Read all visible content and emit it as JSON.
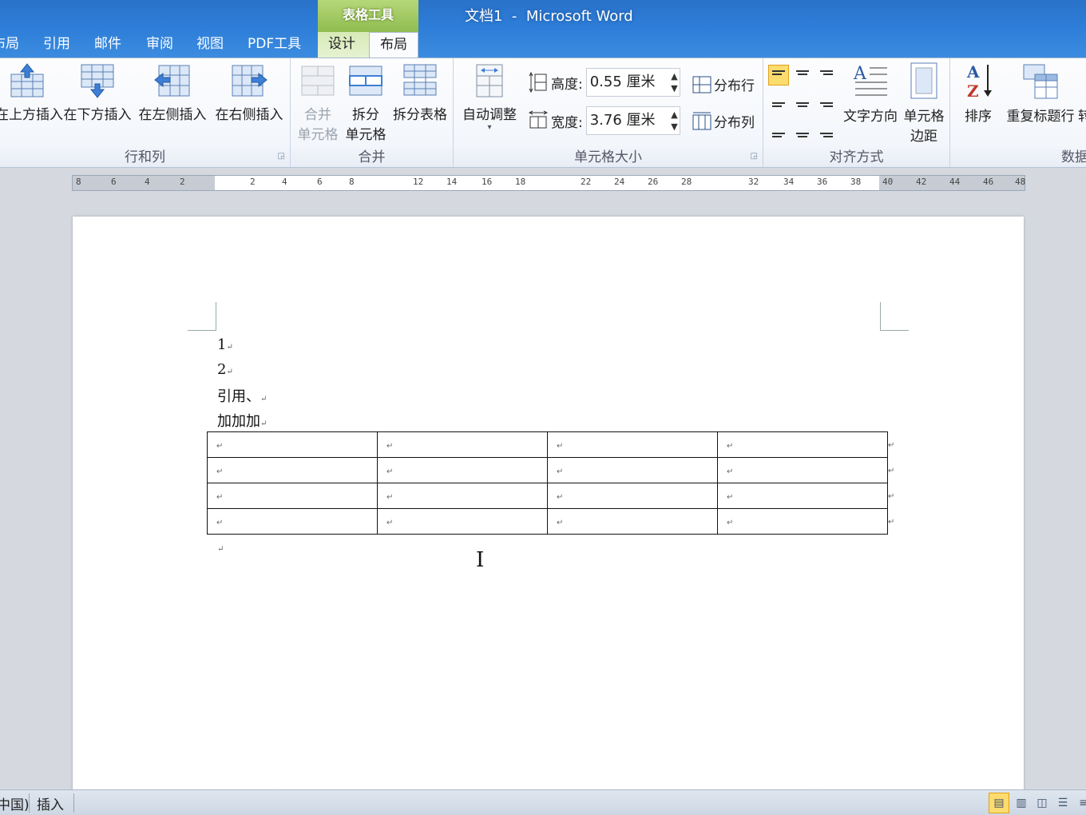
{
  "window": {
    "title": "文档1  -  Microsoft Word",
    "context_group": "表格工具"
  },
  "tabs": [
    {
      "label": "布局"
    },
    {
      "label": "引用"
    },
    {
      "label": "邮件"
    },
    {
      "label": "审阅"
    },
    {
      "label": "视图"
    },
    {
      "label": "PDF工具"
    },
    {
      "label": "设计"
    },
    {
      "label": "布局"
    }
  ],
  "ribbon": {
    "rows_cols": {
      "label": "行和列",
      "insert_above": "在上方插入",
      "insert_below": "在下方插入",
      "insert_left": "在左侧插入",
      "insert_right": "在右侧插入"
    },
    "merge": {
      "label": "合并",
      "merge_cells_1": "合并",
      "merge_cells_2": "单元格",
      "split_cells_1": "拆分",
      "split_cells_2": "单元格",
      "split_table": "拆分表格"
    },
    "cell_size": {
      "label": "单元格大小",
      "autofit": "自动调整",
      "height_label": "高度:",
      "height_value": "0.55 厘米",
      "width_label": "宽度:",
      "width_value": "3.76 厘米",
      "distribute_rows": "分布行",
      "distribute_cols": "分布列"
    },
    "alignment": {
      "label": "对齐方式",
      "text_direction": "文字方向",
      "cell_margins_1": "单元格",
      "cell_margins_2": "边距"
    },
    "data": {
      "label": "数据",
      "sort": "排序",
      "repeat_header": "重复标题行"
    }
  },
  "ruler": {
    "ticks": [
      "8",
      "6",
      "4",
      "2",
      "2",
      "4",
      "6",
      "8",
      "12",
      "14",
      "16",
      "18",
      "22",
      "24",
      "26",
      "28",
      "32",
      "34",
      "36",
      "38",
      "40",
      "42",
      "44",
      "46",
      "48"
    ]
  },
  "document": {
    "paragraphs": [
      "1",
      "2",
      "引用、",
      "加加加"
    ],
    "paragraph_mark": "↵",
    "table": {
      "rows": 4,
      "cols": 4
    }
  },
  "statusbar": {
    "language": "中国)",
    "mode": "插入"
  }
}
